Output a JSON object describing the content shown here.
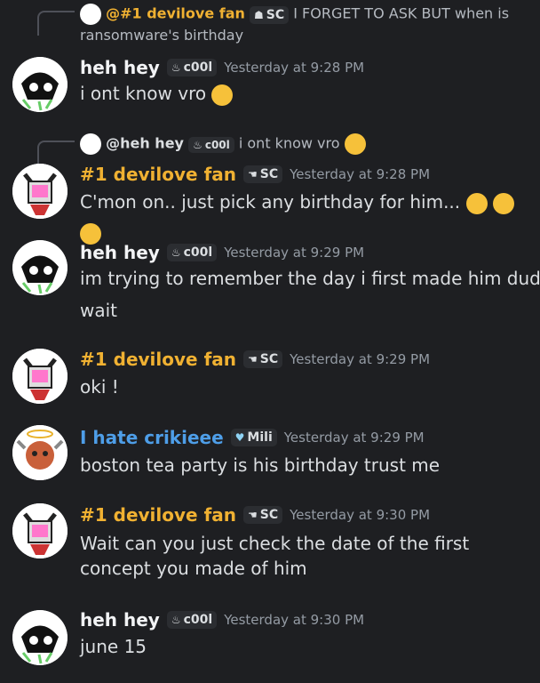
{
  "colors": {
    "background": "#1e1f22",
    "fan_name": "#f0b132",
    "hey_name": "#f2f3f5",
    "crikieee_name": "#4e9ee8",
    "timestamp": "#949ba4"
  },
  "reply1": {
    "author": "@#1 devilove fan",
    "tag": "SC",
    "text": "I FORGET TO ASK BUT when is",
    "text2": "ransomware's birthday"
  },
  "msg1": {
    "author": "heh hey",
    "tag": "c00l",
    "time": "Yesterday at 9:28 PM",
    "text": "i ont know vro"
  },
  "reply2": {
    "author": "@heh hey",
    "tag": "c00l",
    "text": "i ont know vro"
  },
  "msg2": {
    "author": "#1 devilove fan",
    "tag": "SC",
    "time": "Yesterday at 9:28 PM",
    "text": "C'mon on.. just pick any birthday for him..."
  },
  "msg3": {
    "author": "heh hey",
    "tag": "c00l",
    "time": "Yesterday at 9:29 PM",
    "line1": "im trying to remember the day i first made him dud",
    "line2": "wait"
  },
  "msg4": {
    "author": "#1 devilove fan",
    "tag": "SC",
    "time": "Yesterday at 9:29 PM",
    "text": "oki !"
  },
  "msg5": {
    "author": "I hate crikieee",
    "tag": "Mili",
    "time": "Yesterday at 9:29 PM",
    "text": "boston tea party is his birthday trust me"
  },
  "msg6": {
    "author": "#1 devilove fan",
    "tag": "SC",
    "time": "Yesterday at 9:30 PM",
    "line1": "Wait can you just check the date of the first",
    "line2": "concept you made of him"
  },
  "msg7": {
    "author": "heh hey",
    "tag": "c00l",
    "time": "Yesterday at 9:30 PM",
    "text": "june 15"
  }
}
